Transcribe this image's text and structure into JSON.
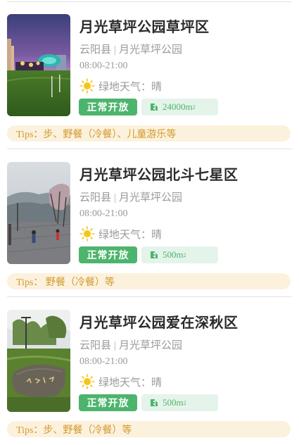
{
  "cards": [
    {
      "title": "月光草坪公园草坪区",
      "county": "云阳县",
      "park": "月光草坪公园",
      "hours": "08:00-21:00",
      "weather": "绿地天气：晴",
      "status": "正常开放",
      "area_value": "24000m",
      "area_unit_sup": "2",
      "tips": "Tips：步、野餐（冷餐）、儿童游乐等"
    },
    {
      "title": "月光草坪公园北斗七星区",
      "county": "云阳县",
      "park": "月光草坪公园",
      "hours": "08:00-21:00",
      "weather": "绿地天气：晴",
      "status": "正常开放",
      "area_value": "500m",
      "area_unit_sup": "2",
      "tips": "Tips： 野餐（冷餐）等"
    },
    {
      "title": "月光草坪公园爱在深秋区",
      "county": "云阳县",
      "park": "月光草坪公园",
      "hours": "08:00-21:00",
      "weather": "绿地天气：晴",
      "status": "正常开放",
      "area_value": "500m",
      "area_unit_sup": "2",
      "tips": "Tips：步、野餐（冷餐）等"
    }
  ],
  "icons": {
    "weather": "sun-icon",
    "area": "area-ruler-icon"
  },
  "colors": {
    "status_green": "#4cb46c",
    "area_bg": "#e5f4ea",
    "tips_bg": "#fcf1dc",
    "tips_text": "#d29a2f",
    "sun": "#f5c518"
  }
}
